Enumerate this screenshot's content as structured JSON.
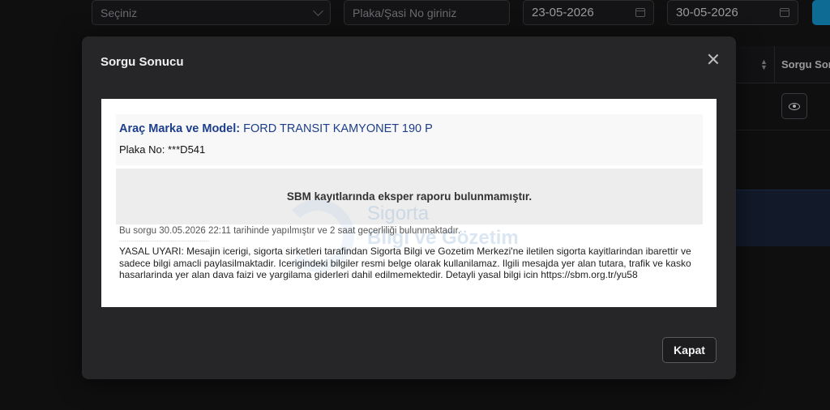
{
  "filters": {
    "select_placeholder": "Seçiniz",
    "plate_placeholder": "Plaka/Şasi No giriniz",
    "date_from": "23-05-2026",
    "date_to": "30-05-2026"
  },
  "table": {
    "header_result": "Sorgu Sonucu"
  },
  "modal": {
    "title": "Sorgu Sonucu",
    "vehicle_label": "Araç Marka ve Model:",
    "vehicle_value": "FORD TRANSIT KAMYONET 190 P",
    "plate_label": "Plaka No:",
    "plate_value": "***D541",
    "no_report": "SBM kayıtlarında eksper raporu bulunmamıştır.",
    "query_info": "Bu sorgu 30.05.2026 22:11 tarihinde yapılmıştır ve 2 saat geçerliliği bulunmaktadır.",
    "legal_text": "YASAL UYARI: Mesajin icerigi, sigorta sirketleri tarafindan Sigorta Bilgi ve Gozetim Merkezi'ne iletilen sigorta kayitlarindan ibarettir ve sadece bilgi amacli paylasilmaktadir. Icerigindeki bilgiler resmi belge olarak kullanilamaz. Ilgili mesajda yer alan tutara, trafik ve kasko hasarlarinda yer alan dava faizi ve yargilama giderleri dahil edilmemektedir. Detayli yasal bilgi icin https://sbm.org.tr/yu58",
    "watermark_line1": "Sigorta",
    "watermark_line2": "Bilgi ve Gözetim",
    "close_button": "Kapat"
  }
}
